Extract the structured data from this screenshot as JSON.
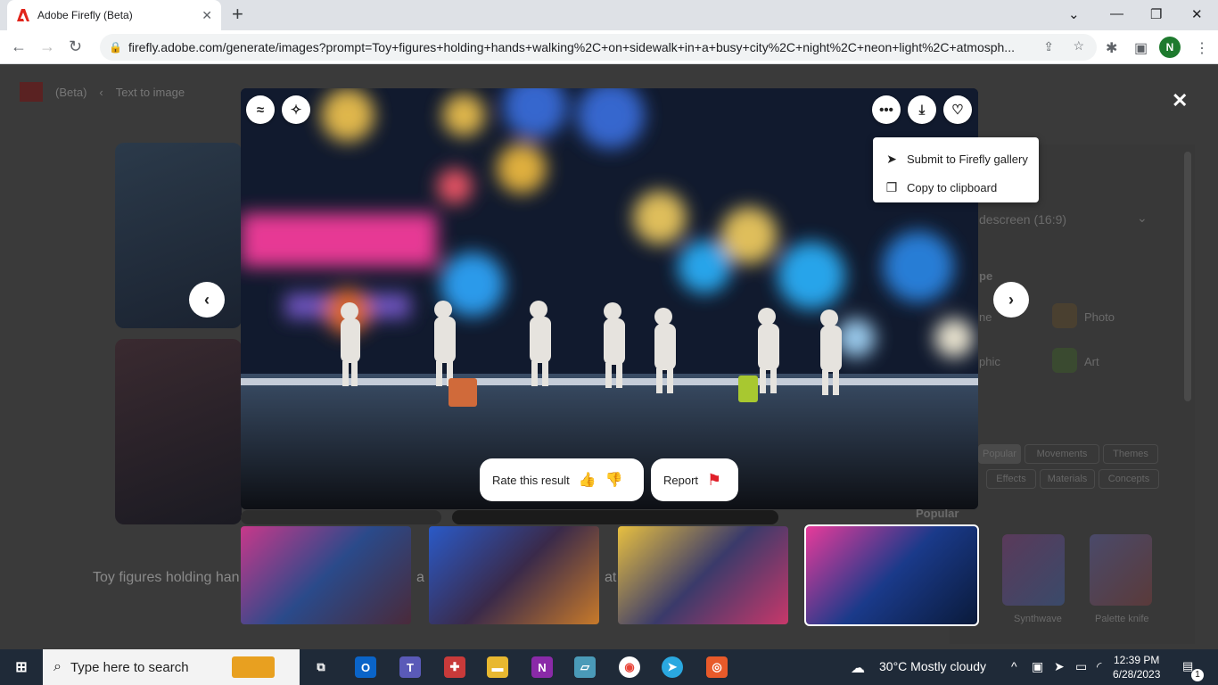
{
  "browser": {
    "tab_title": "Adobe Firefly (Beta)",
    "url": "firefly.adobe.com/generate/images?prompt=Toy+figures+holding+hands+walking%2C+on+sidewalk+in+a+busy+city%2C+night%2C+neon+light%2C+atmosph...",
    "profile_initial": "N"
  },
  "page": {
    "beta_label": "(Beta)",
    "breadcrumb": "Text to image",
    "aspect_value": "descreen (16:9)",
    "content_type_label": "pe",
    "type_none": "ne",
    "type_photo": "Photo",
    "type_graphic": "phic",
    "type_art": "Art",
    "style_tabs": [
      "Popular",
      "Movements",
      "Themes"
    ],
    "style_tabs2": [
      "Effects",
      "Materials",
      "Concepts"
    ],
    "popular_heading": "Popular",
    "style_thumbs": [
      "Synthwave",
      "Palette knife"
    ],
    "prompt_text": "Toy figures holding han",
    "prompt_frag1": "a",
    "prompt_frag2": "at"
  },
  "viewer": {
    "menu": {
      "submit": "Submit to Firefly gallery",
      "copy": "Copy to clipboard"
    },
    "rate_label": "Rate this result",
    "report_label": "Report"
  },
  "taskbar": {
    "search_placeholder": "Type here to search",
    "weather": "30°C  Mostly cloudy",
    "time": "12:39 PM",
    "date": "6/28/2023",
    "notif_count": "1"
  }
}
